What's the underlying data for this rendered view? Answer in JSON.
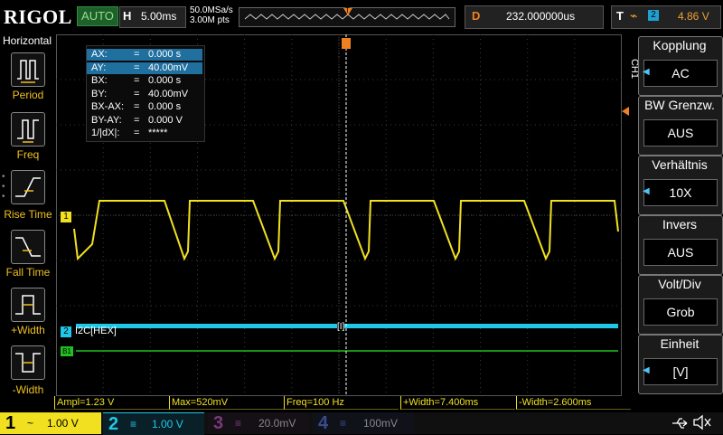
{
  "header": {
    "logo": "RIGOL",
    "run_mode": "AUTO",
    "h_label": "H",
    "timebase": "5.00ms",
    "sample_rate": "50.0MSa/s",
    "memory_depth": "3.00M pts",
    "trigger_pos_marker": "T",
    "delay_label": "D",
    "delay_value": "232.000000us",
    "trig_label": "T",
    "trig_edge": "⌁",
    "trig_channel": "2",
    "trig_level": "4.86 V"
  },
  "left_panel": {
    "title": "Horizontal",
    "items": [
      {
        "label": "Period"
      },
      {
        "label": "Freq"
      },
      {
        "label": "Rise Time"
      },
      {
        "label": "Fall Time"
      },
      {
        "label": "+Width"
      },
      {
        "label": "-Width"
      }
    ]
  },
  "cursor_table": {
    "rows": [
      {
        "key": "AX:",
        "eq": "=",
        "val": "0.000 s",
        "selected": true
      },
      {
        "key": "AY:",
        "eq": "=",
        "val": "40.00mV",
        "selected": true
      },
      {
        "key": "BX:",
        "eq": "=",
        "val": "0.000 s",
        "selected": false
      },
      {
        "key": "BY:",
        "eq": "=",
        "val": "40.00mV",
        "selected": false
      },
      {
        "key": "BX-AX:",
        "eq": "=",
        "val": "0.000 s",
        "selected": false
      },
      {
        "key": "BY-AY:",
        "eq": "=",
        "val": "0.000 V",
        "selected": false
      },
      {
        "key": "1/|dX|:",
        "eq": "=",
        "val": "*****",
        "selected": false
      }
    ]
  },
  "channel_markers": {
    "ch1": "1",
    "ch2": "2",
    "bus_label": "I2C[HEX]",
    "b1": "B1",
    "cursor_marker": "[I]"
  },
  "right_panel": {
    "channel_tag": "CH1",
    "menus": [
      {
        "title": "Kopplung",
        "value": "AC"
      },
      {
        "title": "BW Grenzw.",
        "value": "AUS"
      },
      {
        "title": "Verhältnis",
        "value": "10X"
      },
      {
        "title": "Invers",
        "value": "AUS"
      },
      {
        "title": "Volt/Div",
        "value": "Grob"
      },
      {
        "title": "Einheit",
        "value": "[V]"
      }
    ]
  },
  "measurements": [
    {
      "label": "Ampl=1.23 V"
    },
    {
      "label": "Max=520mV"
    },
    {
      "label": "Freq=100 Hz"
    },
    {
      "label": "+Width=7.400ms"
    },
    {
      "label": "-Width=2.600ms"
    }
  ],
  "channels": [
    {
      "num": "1",
      "coupling": "~",
      "scale": "1.00 V",
      "color": "#f0e020"
    },
    {
      "num": "2",
      "coupling": "≡",
      "scale": "1.00 V",
      "color": "#20c8e8"
    },
    {
      "num": "3",
      "coupling": "≡",
      "scale": "20.0mV",
      "color": "#c040c0"
    },
    {
      "num": "4",
      "coupling": "≡",
      "scale": "100mV",
      "color": "#3070e0"
    }
  ],
  "colors": {
    "ch1": "#f0e020",
    "ch2": "#20c8e8",
    "bus": "#20c020",
    "trigger": "#f08020",
    "grid": "#3a3a3a"
  },
  "icons": {
    "usb": "usb-icon",
    "speaker": "speaker-muted-icon"
  }
}
